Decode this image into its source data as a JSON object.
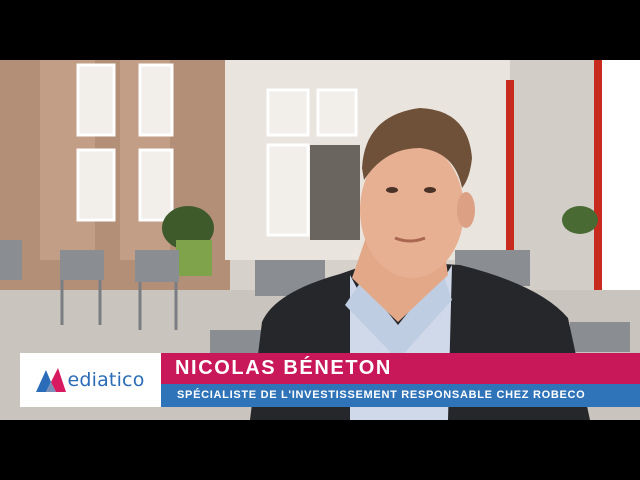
{
  "lower_third": {
    "logo_text": "ediatico",
    "name": "NICOLAS  BÉNETON",
    "title": "SPÉCIALISTE DE L'INVESTISSEMENT RESPONSABLE CHEZ ROBECO"
  },
  "colors": {
    "name_bar": "#c8185a",
    "title_bar": "#2f73b9",
    "logo_blue": "#2b6cb8",
    "logo_pink": "#d81b60"
  }
}
